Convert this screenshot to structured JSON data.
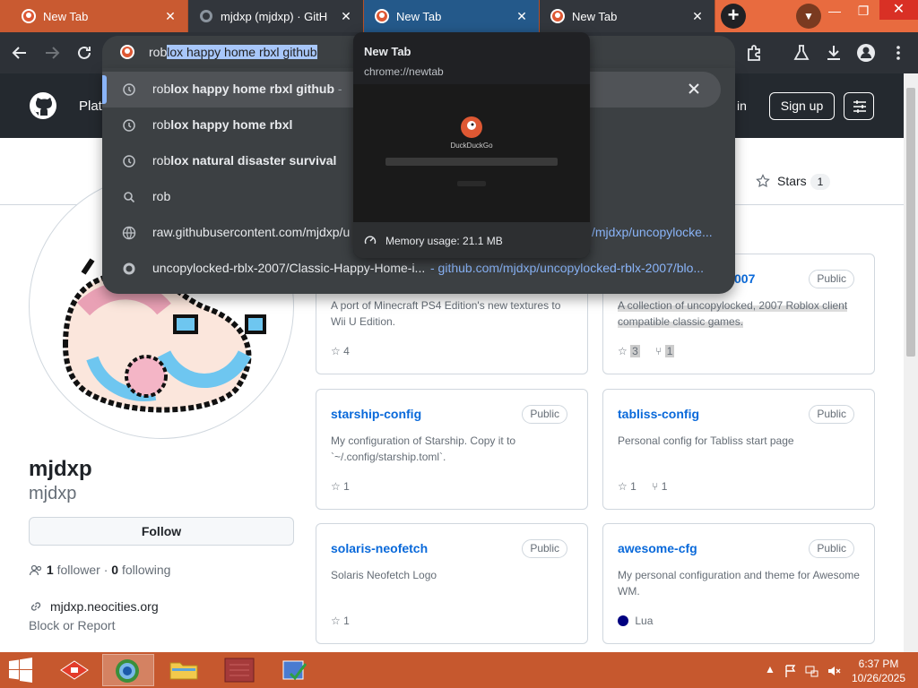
{
  "tabs": [
    {
      "title": "New Tab"
    },
    {
      "title": "mjdxp (mjdxp) · GitHub"
    },
    {
      "title": "New Tab"
    },
    {
      "title": "New Tab"
    }
  ],
  "window": {
    "new_tab": "+",
    "close": "✕",
    "minimize": "—",
    "restore": "❐"
  },
  "omnibox": {
    "typed": "rob",
    "completion": "lox happy home rbxl github"
  },
  "suggestions": [
    {
      "bold_prefix": "rob",
      "bold_rest": "lox happy home rbxl github",
      "extra": " - "
    },
    {
      "bold_prefix": "rob",
      "bold_rest": "lox happy home rbxl"
    },
    {
      "bold_prefix": "rob",
      "bold_rest": "lox natural disaster survival"
    },
    {
      "text": "rob"
    },
    {
      "text": "raw.githubusercontent.com/mjdxp/u",
      "url": "/mjdxp/uncopylocke..."
    },
    {
      "text": "uncopylocked-rblx-2007/Classic-Happy-Home-i...",
      "url": "- github.com/mjdxp/uncopylocked-rblx-2007/blo..."
    }
  ],
  "hovercard": {
    "title": "New Tab",
    "url": "chrome://newtab",
    "brand": "DuckDuckGo",
    "memory": "Memory usage: 21.1 MB"
  },
  "github": {
    "platform": "Plat",
    "sign_in": "in",
    "sign_up": "Sign up",
    "stars_tab": "Stars",
    "stars_count": "1"
  },
  "profile": {
    "name": "mjdxp",
    "login": "mjdxp",
    "follow": "Follow",
    "followers_count": "1",
    "followers_label": "follower",
    "following_count": "0",
    "following_label": "following",
    "website": "mjdxp.neocities.org",
    "block": "Block or Report"
  },
  "cards": [
    {
      "name": "",
      "public": "",
      "desc": "A port of Minecraft PS4 Edition's new textures to Wii U Edition.",
      "stars": "4",
      "forks": "",
      "lang": ""
    },
    {
      "name": "007",
      "public": "Public",
      "desc": "A collection of uncopylocked, 2007 Roblox client compatible classic games.",
      "stars": "3",
      "forks": "1",
      "lang": ""
    },
    {
      "name": "starship-config",
      "public": "Public",
      "desc": "My configuration of Starship. Copy it to `~/.config/starship.toml`.",
      "stars": "1",
      "forks": "",
      "lang": ""
    },
    {
      "name": "tabliss-config",
      "public": "Public",
      "desc": "Personal config for Tabliss start page",
      "stars": "1",
      "forks": "1",
      "lang": ""
    },
    {
      "name": "solaris-neofetch",
      "public": "Public",
      "desc": "Solaris Neofetch Logo",
      "stars": "1",
      "forks": "",
      "lang": ""
    },
    {
      "name": "awesome-cfg",
      "public": "Public",
      "desc": "My personal configuration and theme for Awesome WM.",
      "stars": "",
      "forks": "",
      "lang": "Lua"
    }
  ],
  "taskbar": {
    "time": "6:37 PM",
    "date": "10/26/2025"
  },
  "colors": {
    "accent_tabstrip": "#e86b3f",
    "toolbar": "#2d3137",
    "github_header": "#24292f",
    "link": "#0969da",
    "lua": "#000080"
  }
}
